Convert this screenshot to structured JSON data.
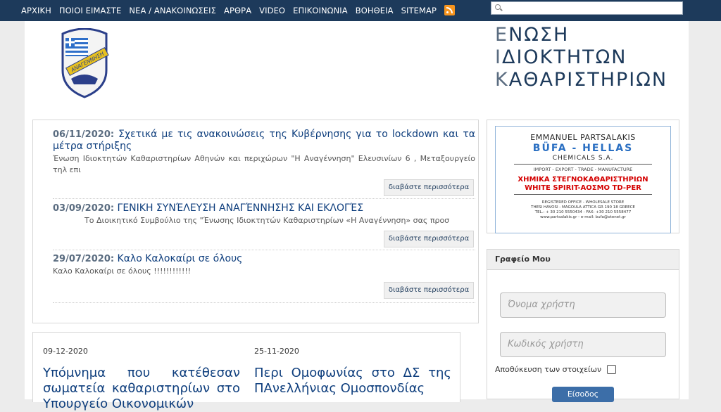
{
  "nav": {
    "items": [
      "ΑΡΧΙΚΗ",
      "ΠΟΙΟΙ ΕΙΜΑΣΤΕ",
      "ΝΕΑ / ΑΝΑΚΟΙΝΩΣΕΙΣ",
      "ΑΡΘΡΑ",
      "VIDEO",
      "ΕΠΙΚΟΙΝΩΝΙΑ",
      "ΒΟΗΘΕΙΑ",
      "SITEMAP"
    ],
    "rss_icon": "rss-icon"
  },
  "search": {
    "placeholder": "",
    "value": ""
  },
  "brand": {
    "logo_text": "ΑΝΑΓΕΝΝΗΣΗ",
    "lines": [
      {
        "first": "Ε",
        "rest": "ΝΩΣΗ"
      },
      {
        "first": "Ι",
        "rest": "ΔΙΟΚΤΗΤΩΝ"
      },
      {
        "first": "Κ",
        "rest": "ΑΘΑΡΙΣΤΗΡΙΩΝ"
      }
    ]
  },
  "news": [
    {
      "date": "06/11/2020:",
      "title": "Σχετικά με τις ανακοινώσεις της Κυβέρνησης για το lockdown και τα μέτρα στήριξης",
      "excerpt": "Ένωση Ιδιοκτητών Καθαριστηρίων Αθηνών και περιχώρων \"Η Αναγέννηση\" Ελευσινίων 6 , Μεταξουργείο τηλ επι",
      "more": "διαβάστε περισσότερα"
    },
    {
      "date": "03/09/2020:",
      "title": "ΓΕΝΙΚΗ ΣΥΝΈΛΕΥΣΗ ΑΝΑΓΈΝΝΗΣΗΣ ΚΑΙ ΕΚΛΟΓΈΣ",
      "excerpt": "Το Διοικητικό Συμβούλιο της \"Ένωσης Ιδιοκτητών Καθαριστηρίων «Η Αναγέννηση» σας προσ",
      "more": "διαβάστε περισσότερα"
    },
    {
      "date": "29/07/2020:",
      "title": "Καλο Καλοκαίρι σε όλους",
      "excerpt": "Καλο Καλοκαίρι σε όλους !!!!!!!!!!!!",
      "more": "διαβάστε περισσότερα"
    }
  ],
  "articles": [
    {
      "date": "09-12-2020",
      "title": "Υπόμνημα που κατέθεσαν σωματεία καθαριστηρίων στο Υπουργείο Οικονομικών"
    },
    {
      "date": "25-11-2020",
      "title": "Περι Ομοφωνίας στο ΔΣ της ΠΑνελλήνιας Ομοσπονδίας"
    }
  ],
  "ad": {
    "line1": "EMMANUEL PARTSALAKIS",
    "line2": "BÜFA - HELLAS",
    "line3": "CHEMICALS S.A.",
    "line4": "IMPORT - EXPORT - TRADE - MANUFACTURE",
    "line5": "ΧΗΜΙΚΑ ΣΤΕΓΝΟΚΑΘΑΡΙΣΤΗΡΙΩΝ",
    "line6": "WHITE SPIRIT-ΑΟΣΜΟ TD-PER",
    "line7": "REGISTERED OFFICE - WHOLESALE STORE",
    "line8": "THESI HAVOSI - MAGOULA ATTICA GR 190 18 GREECE",
    "line9": "TEL.: + 30 210 5550434 - FAX: +30 210 5558477",
    "line10": "www.partsalakis.gr - e-mail: bufa@otenet.gr"
  },
  "login": {
    "heading": "Γραφείο Μου",
    "username_placeholder": "Όνομα χρήστη",
    "password_placeholder": "Κωδικός χρήστη",
    "remember_label": "Αποθύκευση των στοιχείων",
    "submit_label": "Είσοδος"
  },
  "colors": {
    "topbar": "#1d3a5b",
    "link": "#0e3e7d",
    "rss": "#f7941d",
    "button": "#3c6ea8"
  }
}
